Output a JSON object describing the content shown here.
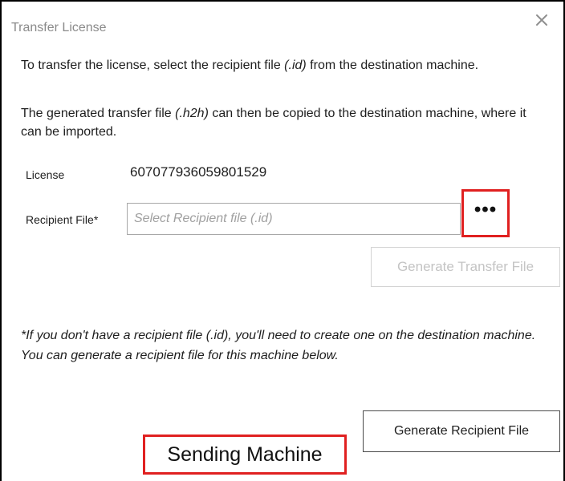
{
  "dialog": {
    "title": "Transfer License",
    "close_icon": "close-icon"
  },
  "intro": {
    "p1_before": "To transfer the license, select the recipient file ",
    "p1_ext": "(.id)",
    "p1_after": " from the destination machine.",
    "p2_before": "The generated transfer file ",
    "p2_ext": "(.h2h)",
    "p2_after": " can then be copied to the destination machine, where it can be imported."
  },
  "license": {
    "label": "License",
    "value": "607077936059801529"
  },
  "recipient": {
    "label": "Recipient File*",
    "placeholder": "Select Recipient file (.id)",
    "browse_label": "•••",
    "browse_icon": "ellipsis-icon"
  },
  "buttons": {
    "generate_transfer": "Generate Transfer File",
    "generate_recipient": "Generate Recipient File"
  },
  "note": "*If you don't have a recipient file (.id), you'll need to create one on the destination machine. You can generate a recipient file for this machine below.",
  "annotation": {
    "label": "Sending Machine",
    "highlight_color": "#e02020"
  }
}
